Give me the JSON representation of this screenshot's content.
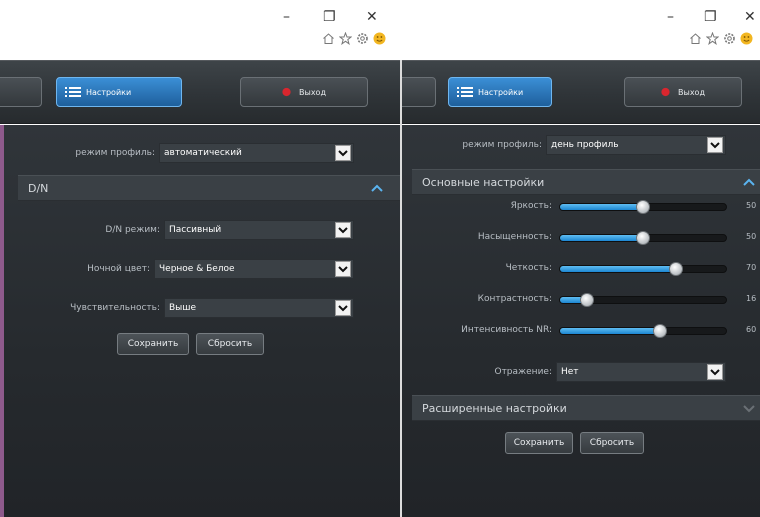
{
  "window": {
    "minimize": "–",
    "restore": "❐",
    "close": "✕"
  },
  "nav": {
    "settings_label": "Настройки",
    "exit_label": "Выход"
  },
  "left": {
    "profile": {
      "label": "режим профиль:",
      "value": "автоматический"
    },
    "section_dn": "D/N",
    "dn_mode": {
      "label": "D/N режим:",
      "value": "Пассивный"
    },
    "night_color": {
      "label": "Ночной цвет:",
      "value": "Черное & Белое"
    },
    "sensitivity": {
      "label": "Чувствительность:",
      "value": "Выше"
    },
    "save": "Сохранить",
    "reset": "Сбросить"
  },
  "right": {
    "profile": {
      "label": "режим профиль:",
      "value": "день профиль"
    },
    "section_basic": "Основные настройки",
    "sliders": [
      {
        "label": "Яркость:",
        "value": 50,
        "display": "50"
      },
      {
        "label": "Насыщенность:",
        "value": 50,
        "display": "50"
      },
      {
        "label": "Четкость:",
        "value": 70,
        "display": "70"
      },
      {
        "label": "Контрастность:",
        "value": 16,
        "display": "16"
      },
      {
        "label": "Интенсивность NR:",
        "value": 60,
        "display": "60"
      }
    ],
    "mirror": {
      "label": "Отражение:",
      "value": "Нет"
    },
    "section_advanced": "Расширенные настройки",
    "save": "Сохранить",
    "reset": "Сбросить"
  },
  "colors": {
    "accent": "#2a7cc7",
    "panel_bg": "#2b3034",
    "section_bg": "#3a4045"
  },
  "icons": [
    "home-icon",
    "star-icon",
    "gear-icon",
    "smiley-icon",
    "menu-list-icon",
    "exit-icon",
    "dropdown-arrow-icon",
    "chevron-up-icon",
    "chevron-down-icon"
  ]
}
